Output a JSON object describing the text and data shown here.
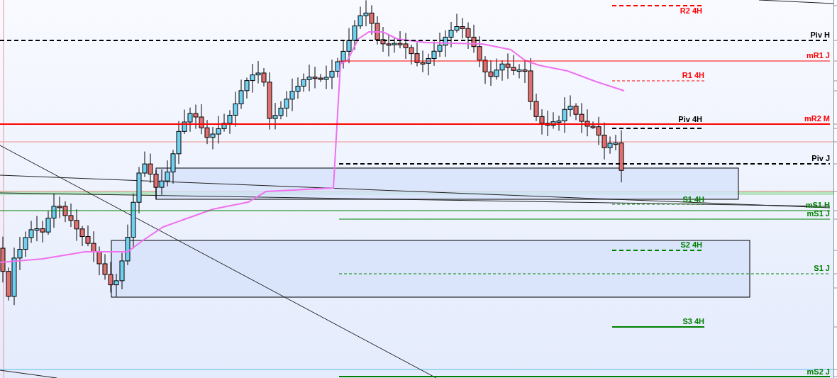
{
  "levels": [
    {
      "label": "R2 4H",
      "color": "#ff0000",
      "kind": "dashed-thick"
    },
    {
      "label": "Piv H",
      "color": "#000000",
      "kind": "dashed-thick"
    },
    {
      "label": "mR1 J",
      "color": "#ff0000",
      "kind": "solid-thin"
    },
    {
      "label": "R1 4H",
      "color": "#ff0000",
      "kind": "dashed-thin"
    },
    {
      "label": "Piv 4H",
      "color": "#000000",
      "kind": "dashed-thick"
    },
    {
      "label": "mR2 M",
      "color": "#ff0000",
      "kind": "solid-thick"
    },
    {
      "label": "Piv J",
      "color": "#000000",
      "kind": "dashed-thick"
    },
    {
      "label": "S1 4H",
      "color": "#008000",
      "kind": "dashed-thin"
    },
    {
      "label": "mS1 H",
      "color": "#008000",
      "kind": "solid-thin"
    },
    {
      "label": "mS1 J",
      "color": "#008000",
      "kind": "solid-thin"
    },
    {
      "label": "S2 4H",
      "color": "#008000",
      "kind": "dashed-thick"
    },
    {
      "label": "S1 J",
      "color": "#008000",
      "kind": "dashed-thin"
    },
    {
      "label": "S3 4H",
      "color": "#008000",
      "kind": "solid-thick"
    },
    {
      "label": "mS2 J",
      "color": "#008000",
      "kind": "solid-thick"
    }
  ]
}
